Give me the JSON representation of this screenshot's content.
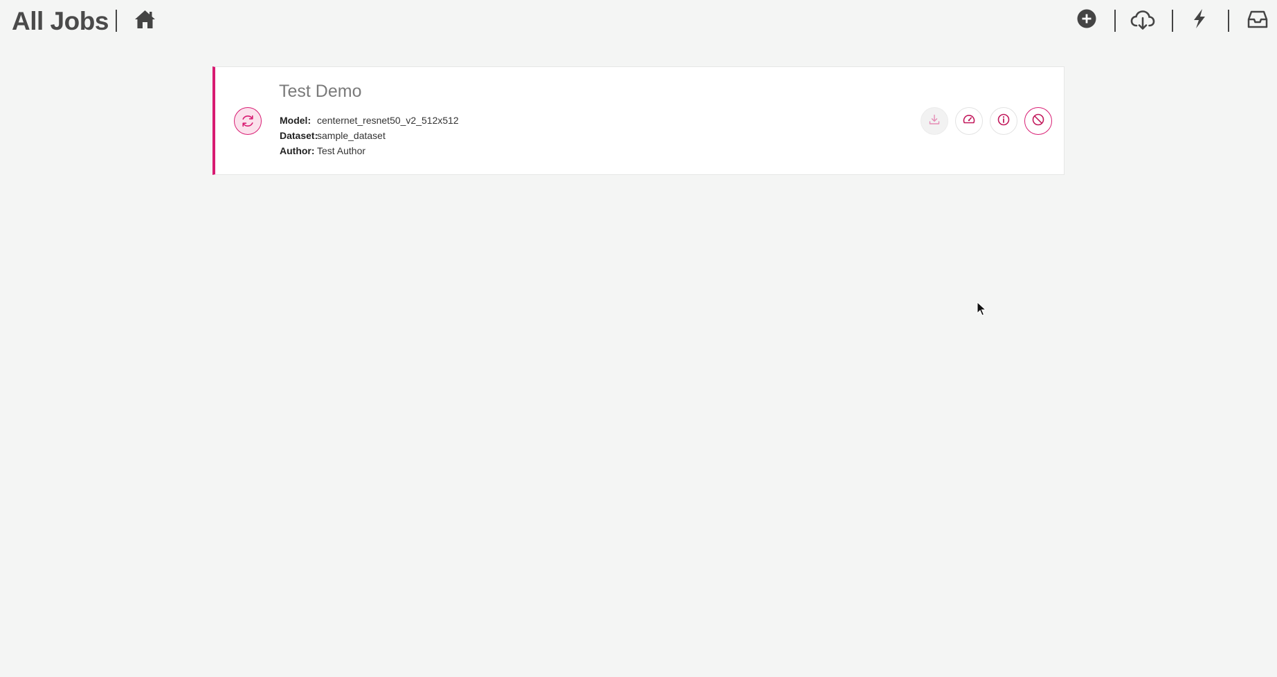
{
  "header": {
    "title": "All Jobs",
    "icons": {
      "home": "home-icon",
      "add": "plus-circle-icon",
      "cloud_download": "cloud-download-icon",
      "lightning": "bolt-icon",
      "inbox": "inbox-icon"
    }
  },
  "job": {
    "name": "Test Demo",
    "status_icon": "sync-icon",
    "fields": {
      "model_label": "Model:",
      "model_value": "centernet_resnet50_v2_512x512",
      "dataset_label": "Dataset:",
      "dataset_value": "sample_dataset",
      "author_label": "Author:",
      "author_value": "Test Author"
    },
    "actions": [
      "download-icon",
      "dashboard-gauge-icon",
      "info-icon",
      "cancel-icon"
    ]
  },
  "colors": {
    "accent": "#d81b72",
    "background": "#f4f5f4",
    "card": "#ffffff",
    "text_dark": "#444444"
  }
}
